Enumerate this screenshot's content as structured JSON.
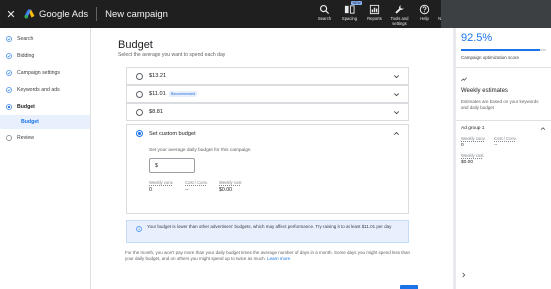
{
  "topbar": {
    "close_glyph": "✕",
    "brand": "Google Ads",
    "page_name": "New campaign",
    "tools": [
      {
        "label": "Search",
        "icon": "search-icon"
      },
      {
        "label": "Spacing",
        "icon": "spacing-icon",
        "badge": "NEW"
      },
      {
        "label": "Reports",
        "icon": "reports-icon"
      },
      {
        "label": "Tools and settings",
        "icon": "wrench-icon"
      },
      {
        "label": "Help",
        "icon": "help-icon"
      },
      {
        "label": "Notifications",
        "icon": "bell-icon"
      }
    ]
  },
  "sidebar": {
    "items": [
      {
        "label": "Search",
        "icon": "check-circle-icon"
      },
      {
        "label": "Bidding",
        "icon": "check-circle-icon"
      },
      {
        "label": "Campaign settings",
        "icon": "check-circle-icon"
      },
      {
        "label": "Keywords and ads",
        "icon": "check-circle-icon"
      },
      {
        "label": "Budget",
        "icon": "current-step-icon"
      },
      {
        "label": "Budget",
        "sub": true
      },
      {
        "label": "Review",
        "icon": "empty-circle-icon"
      }
    ]
  },
  "main": {
    "title": "Budget",
    "subtitle": "Select the average you want to spend each day",
    "options": [
      {
        "amount": "$13.21",
        "badge": ""
      },
      {
        "amount": "$11.01",
        "badge": "Recommended"
      },
      {
        "amount": "$8.81",
        "badge": ""
      }
    ],
    "custom": {
      "label": "Set custom budget",
      "prompt": "Set your average daily budget for this campaign",
      "value": "$",
      "stats": [
        {
          "label": "Weekly conv.",
          "value": "0"
        },
        {
          "label": "Cost / Conv.",
          "value": "--"
        },
        {
          "label": "Weekly cost",
          "value": "$0.00"
        }
      ]
    },
    "info_text": "Your budget is lower than other advertisers' budgets, which may affect performance. Try raising it to at least $11.01 per day",
    "footnote": "For the month, you won't pay more than your daily budget times the average number of days in a month. Some days you might spend less than your daily budget, and on others you might spend up to twice as much.",
    "learn_more": "Learn more"
  },
  "right_panel": {
    "score": "92.5%",
    "score_fraction": 0.925,
    "score_label": "Campaign optimization score",
    "weekly_title": "Weekly estimates",
    "weekly_text": "Estimates are based on your keywords and daily budget",
    "group_title": "Ad group 1",
    "stats": [
      {
        "label": "Weekly conv.",
        "value": "0"
      },
      {
        "label": "Cost / Conv.",
        "value": "--"
      },
      {
        "label": "Weekly cost",
        "value": "$0.00"
      }
    ]
  },
  "colors": {
    "accent": "#1a73e8",
    "topbar": "#1f1f1f",
    "info_bg": "#e8f0fe"
  }
}
